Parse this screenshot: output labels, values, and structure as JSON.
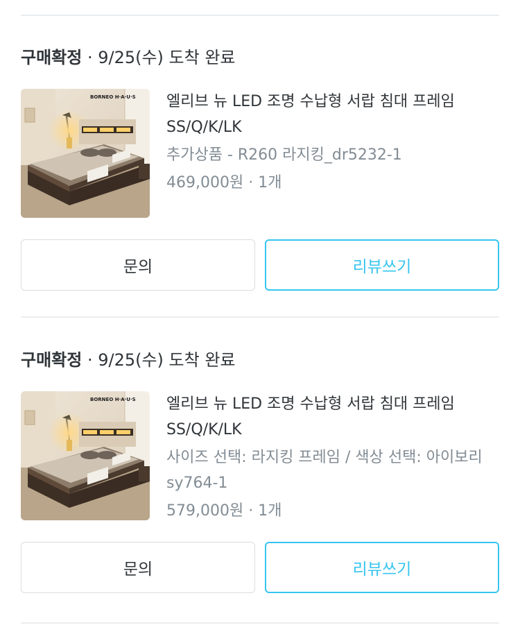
{
  "orders": [
    {
      "status_bold": "구매확정",
      "status_rest": " · 9/25(수) 도착 완료",
      "product_title": "엘리브 뉴 LED 조명 수납형 서랍 침대 프레임 SS/Q/K/LK",
      "option": "추가상품 - R260 라지킹_dr5232-1",
      "price_qty": "469,000원 · 1개",
      "brand_logo": "BORNEO H·A·U·S",
      "ask_label": "문의",
      "review_label": "리뷰쓰기"
    },
    {
      "status_bold": "구매확정",
      "status_rest": " · 9/25(수) 도착 완료",
      "product_title": "엘리브 뉴 LED 조명 수납형 서랍 침대 프레임 SS/Q/K/LK",
      "option": "사이즈 선택: 라지킹 프레임 / 색상 선택: 아이보리 sy764-1",
      "price_qty": "579,000원 · 1개",
      "brand_logo": "BORNEO H·A·U·S",
      "ask_label": "문의",
      "review_label": "리뷰쓰기"
    }
  ],
  "colors": {
    "accent": "#35c5f0",
    "text": "#2f3438",
    "muted": "#828c94",
    "divider": "#eaedef"
  }
}
